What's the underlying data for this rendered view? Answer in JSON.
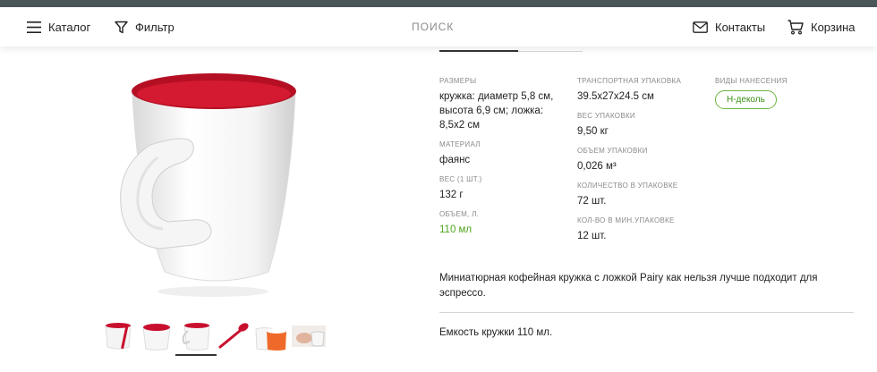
{
  "header": {
    "catalog_label": "Каталог",
    "filter_label": "Фильтр",
    "search_label": "ПОИСК",
    "contacts_label": "Контакты",
    "cart_label": "Корзина"
  },
  "product": {
    "specs_col1": [
      {
        "label": "РАЗМЕРЫ",
        "value": "кружка: диаметр 5,8 см, высота 6,9 см; ложка: 8,5х2 см"
      },
      {
        "label": "МАТЕРИАЛ",
        "value": "фаянс"
      },
      {
        "label": "ВЕС (1 ШТ.)",
        "value": "132 г"
      },
      {
        "label": "ОБЪЕМ, Л.",
        "value": "110 мл"
      }
    ],
    "specs_col2": [
      {
        "label": "ТРАНСПОРТНАЯ УПАКОВКА",
        "value": "39.5x27x24.5 см"
      },
      {
        "label": "ВЕС УПАКОВКИ",
        "value": "9,50 кг"
      },
      {
        "label": "ОБЪЕМ УПАКОВКИ",
        "value": "0,026 м³"
      },
      {
        "label": "КОЛИЧЕСТВО В УПАКОВКЕ",
        "value": "72 шт."
      },
      {
        "label": "КОЛ-ВО В МИН.УПАКОВКЕ",
        "value": "12 шт."
      }
    ],
    "print_methods_label": "ВИДЫ НАНЕСЕНИЯ",
    "print_method_badge": "Н-деколь",
    "description": "Миниатюрная кофейная кружка с ложкой Pairy как нельзя лучше подходит для эспрессо.",
    "capacity_note": "Емкость кружки 110 мл."
  },
  "colors": {
    "accent_green": "#4ea41b",
    "mug_red": "#c8102e",
    "top_strip": "#4a565a"
  }
}
